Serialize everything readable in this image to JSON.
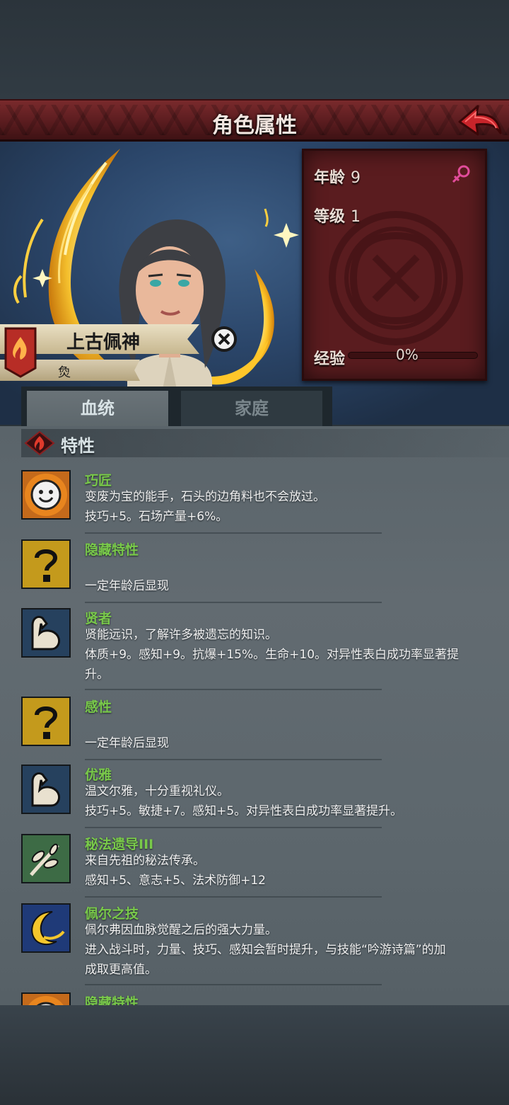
{
  "header": {
    "title": "角色属性"
  },
  "character": {
    "name": "上古佩神",
    "subtitle": "烉",
    "age_label": "年龄",
    "age_value": "9",
    "level_label": "等级",
    "level_value": "1",
    "exp_label": "经验",
    "exp_value": "0%",
    "exp_fraction": 0
  },
  "tabs": [
    {
      "label": "血统",
      "active": true
    },
    {
      "label": "家庭",
      "active": false
    }
  ],
  "section": {
    "title": "特性"
  },
  "traits": [
    {
      "name": "巧匠",
      "icon": "smiley-face-icon",
      "desc1": "变废为宝的能手，石头的边角料也不会放过。",
      "desc2": "技巧+5。石场产量+6%。",
      "desc3": ""
    },
    {
      "name": "隐藏特性",
      "icon": "question-mark-icon",
      "desc1": "",
      "desc2": "一定年龄后显现",
      "desc3": ""
    },
    {
      "name": "贤者",
      "icon": "flexed-arm-icon",
      "desc1": "贤能远识，了解许多被遗忘的知识。",
      "desc2": "体质+9。感知+9。抗爆+15%。生命+10。对异性表白成功率显著提",
      "desc3": "升。"
    },
    {
      "name": "感性",
      "icon": "question-mark-icon",
      "desc1": "",
      "desc2": "一定年龄后显现",
      "desc3": ""
    },
    {
      "name": "优雅",
      "icon": "flexed-arm-icon",
      "desc1": "温文尔雅，十分重视礼仪。",
      "desc2": "技巧+5。敏捷+7。感知+5。对异性表白成功率显著提升。",
      "desc3": ""
    },
    {
      "name": "秘法遗导III",
      "icon": "leaf-branch-icon",
      "desc1": "来自先祖的秘法传承。",
      "desc2": "感知+5、意志+5、法术防御+12",
      "desc3": ""
    },
    {
      "name": "佩尔之技",
      "icon": "crescent-moon-icon",
      "desc1": "佩尔弗因血脉觉醒之后的强大力量。",
      "desc2": "进入战斗时，力量、技巧、感知会暂时提升，与技能“吟游诗篇”的加",
      "desc3": "成取更高值。"
    },
    {
      "name": "隐藏特性",
      "icon": "smiley-face-icon",
      "desc1": "",
      "desc2": "",
      "desc3": ""
    }
  ]
}
